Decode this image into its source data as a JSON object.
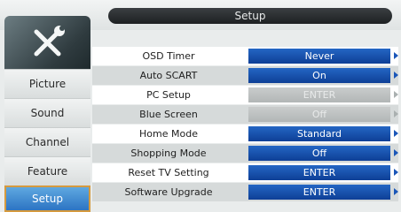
{
  "header": {
    "title": "Setup"
  },
  "sidebar": {
    "icon": "tools-icon",
    "items": [
      {
        "label": "Picture",
        "active": false
      },
      {
        "label": "Sound",
        "active": false
      },
      {
        "label": "Channel",
        "active": false
      },
      {
        "label": "Feature",
        "active": false
      },
      {
        "label": "Setup",
        "active": true
      }
    ]
  },
  "menu": {
    "rows": [
      {
        "label": "OSD Timer",
        "value": "Never",
        "enabled": true
      },
      {
        "label": "Auto SCART",
        "value": "On",
        "enabled": true
      },
      {
        "label": "PC Setup",
        "value": "ENTER",
        "enabled": false
      },
      {
        "label": "Blue Screen",
        "value": "Off",
        "enabled": false
      },
      {
        "label": "Home Mode",
        "value": "Standard",
        "enabled": true
      },
      {
        "label": "Shopping Mode",
        "value": "Off",
        "enabled": true
      },
      {
        "label": "Reset TV Setting",
        "value": "ENTER",
        "enabled": true
      },
      {
        "label": "Software Upgrade",
        "value": "ENTER",
        "enabled": true
      }
    ]
  },
  "colors": {
    "accent_blue": "#1a56b8",
    "active_tab": "#2c74c3",
    "active_border": "#d59a3e",
    "disabled_value": "#b2b6b6"
  }
}
